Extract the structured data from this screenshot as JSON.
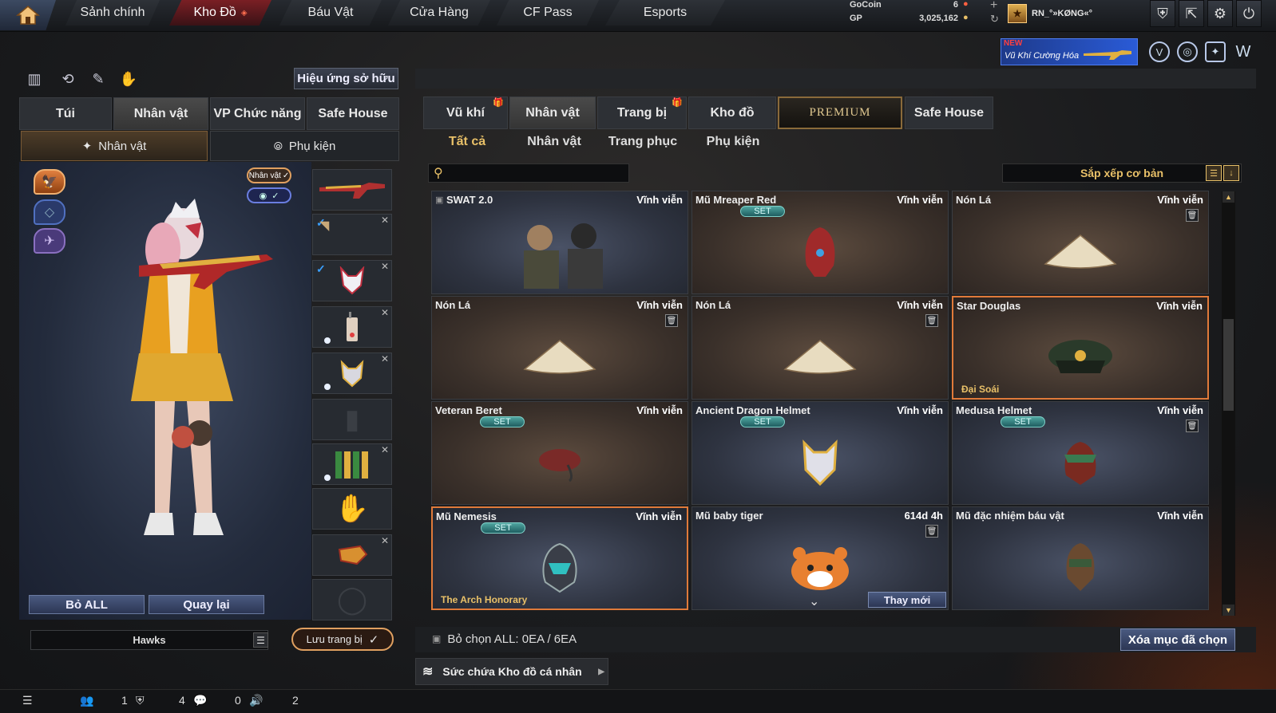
{
  "nav": {
    "home_icon": "home-icon",
    "tabs": [
      "Sảnh chính",
      "Kho Đồ",
      "Báu Vật",
      "Cửa Hàng",
      "CF Pass",
      "Esports"
    ],
    "active_tab": "Kho Đồ"
  },
  "wallet": {
    "gocoin_label": "GoCoin",
    "gocoin_value": "6",
    "gp_label": "GP",
    "gp_value": "3,025,162"
  },
  "user": {
    "name": "RN_°»KØNG«°"
  },
  "promo": {
    "new_label": "NEW",
    "text": "Vũ Khí Cường Hóa"
  },
  "left": {
    "effect_button": "Hiệu ứng sở hữu",
    "tabs": [
      "Túi",
      "Nhân vật",
      "VP Chức năng",
      "Safe House"
    ],
    "active_tab": "Nhân vật",
    "subtabs": [
      "Nhân vật",
      "Phụ kiện"
    ],
    "active_subtab": "Nhân vật",
    "badge_character": "Nhân vật",
    "remove_all": "Bỏ ALL",
    "back": "Quay lại",
    "preset_name": "Hawks",
    "save_button": "Lưu trang bị"
  },
  "right": {
    "tabs": [
      "Vũ khí",
      "Nhân vật",
      "Trang bị",
      "Kho đồ",
      "PREMIUM",
      "Safe House"
    ],
    "active_tab": "Nhân vật",
    "subtabs": [
      "Tất cả",
      "Nhân vật",
      "Trang phục",
      "Phụ kiện"
    ],
    "active_subtab": "Tất cả",
    "search_value": "",
    "sort_label": "Sắp xếp cơ bản",
    "items": [
      {
        "name": "SWAT 2.0",
        "duration": "Vĩnh viễn"
      },
      {
        "name": "Mũ Mreaper Red",
        "duration": "Vĩnh viễn",
        "badge": "SET"
      },
      {
        "name": "Nón Lá",
        "duration": "Vĩnh viễn"
      },
      {
        "name": "Nón Lá",
        "duration": "Vĩnh viễn"
      },
      {
        "name": "Nón Lá",
        "duration": "Vĩnh viễn"
      },
      {
        "name": "Star Douglas",
        "duration": "Vĩnh viễn",
        "footer": "Đại Soái"
      },
      {
        "name": "Veteran Beret",
        "duration": "Vĩnh viễn",
        "badge": "SET"
      },
      {
        "name": "Ancient Dragon Helmet",
        "duration": "Vĩnh viễn",
        "badge": "SET"
      },
      {
        "name": "Medusa Helmet",
        "duration": "Vĩnh viễn",
        "badge": "SET"
      },
      {
        "name": "Mũ Nemesis",
        "duration": "Vĩnh viễn",
        "badge": "SET",
        "footer": "The Arch Honorary"
      },
      {
        "name": "Mũ baby tiger",
        "duration": "614d 4h",
        "action": "Thay mới"
      },
      {
        "name": "Mũ đặc nhiệm báu vật",
        "duration": "Vĩnh viễn"
      }
    ],
    "unselect_all": "Bỏ chọn ALL: 0EA / 6EA",
    "delete_button": "Xóa mục đã chọn",
    "capacity_label": "Sức chứa Kho đồ cá nhân"
  },
  "status": {
    "count1": "1",
    "count2": "4",
    "count3": "0",
    "count4": "2"
  },
  "colors": {
    "accent_gold": "#e8c068",
    "active_nav": "#7a1f24",
    "selected_border": "#e07a3a",
    "set_badge": "#4fa5a0"
  }
}
